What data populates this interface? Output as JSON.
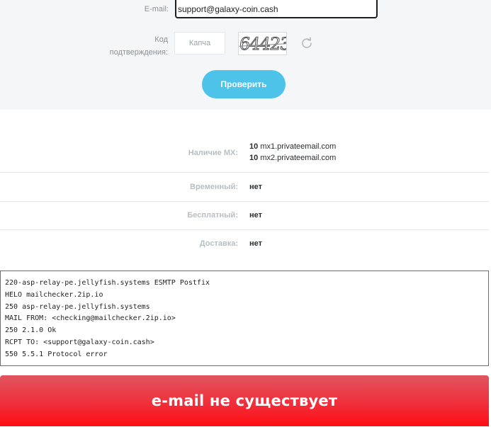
{
  "form": {
    "email_label": "E-mail:",
    "email_value": "support@galaxy-coin.cash",
    "code_label_line1": "Код",
    "code_label_line2": "подтверждения:",
    "captcha_placeholder": "Капча",
    "captcha_text": "64423",
    "refresh_icon": "refresh-icon",
    "check_button_label": "Проверить"
  },
  "results": {
    "mx_label": "Наличие MX:",
    "mx_records": [
      {
        "priority": "10",
        "host": "mx1.privateemail.com"
      },
      {
        "priority": "10",
        "host": "mx2.privateemail.com"
      }
    ],
    "temporary_label": "Временный:",
    "temporary_value": "нет",
    "free_label": "Бесплатный:",
    "free_value": "нет",
    "delivery_label": "Доставка:",
    "delivery_value": "нет"
  },
  "smtp_log": [
    "220-asp-relay-pe.jellyfish.systems ESMTP Postfix",
    "HELO mailchecker.2ip.io",
    "250 asp-relay-pe.jellyfish.systems",
    "MAIL FROM: <checking@mailchecker.2ip.io>",
    "250 2.1.0 Ok",
    "RCPT TO: <support@galaxy-coin.cash>",
    "550 5.5.1 Protocol error"
  ],
  "banner": {
    "text": "e-mail не существует"
  },
  "colors": {
    "button": "#4ec3ea",
    "banner_top": "#e0555f",
    "banner_bottom": "#ff0d12",
    "label": "#b8bec2",
    "value": "#2a2d30"
  }
}
